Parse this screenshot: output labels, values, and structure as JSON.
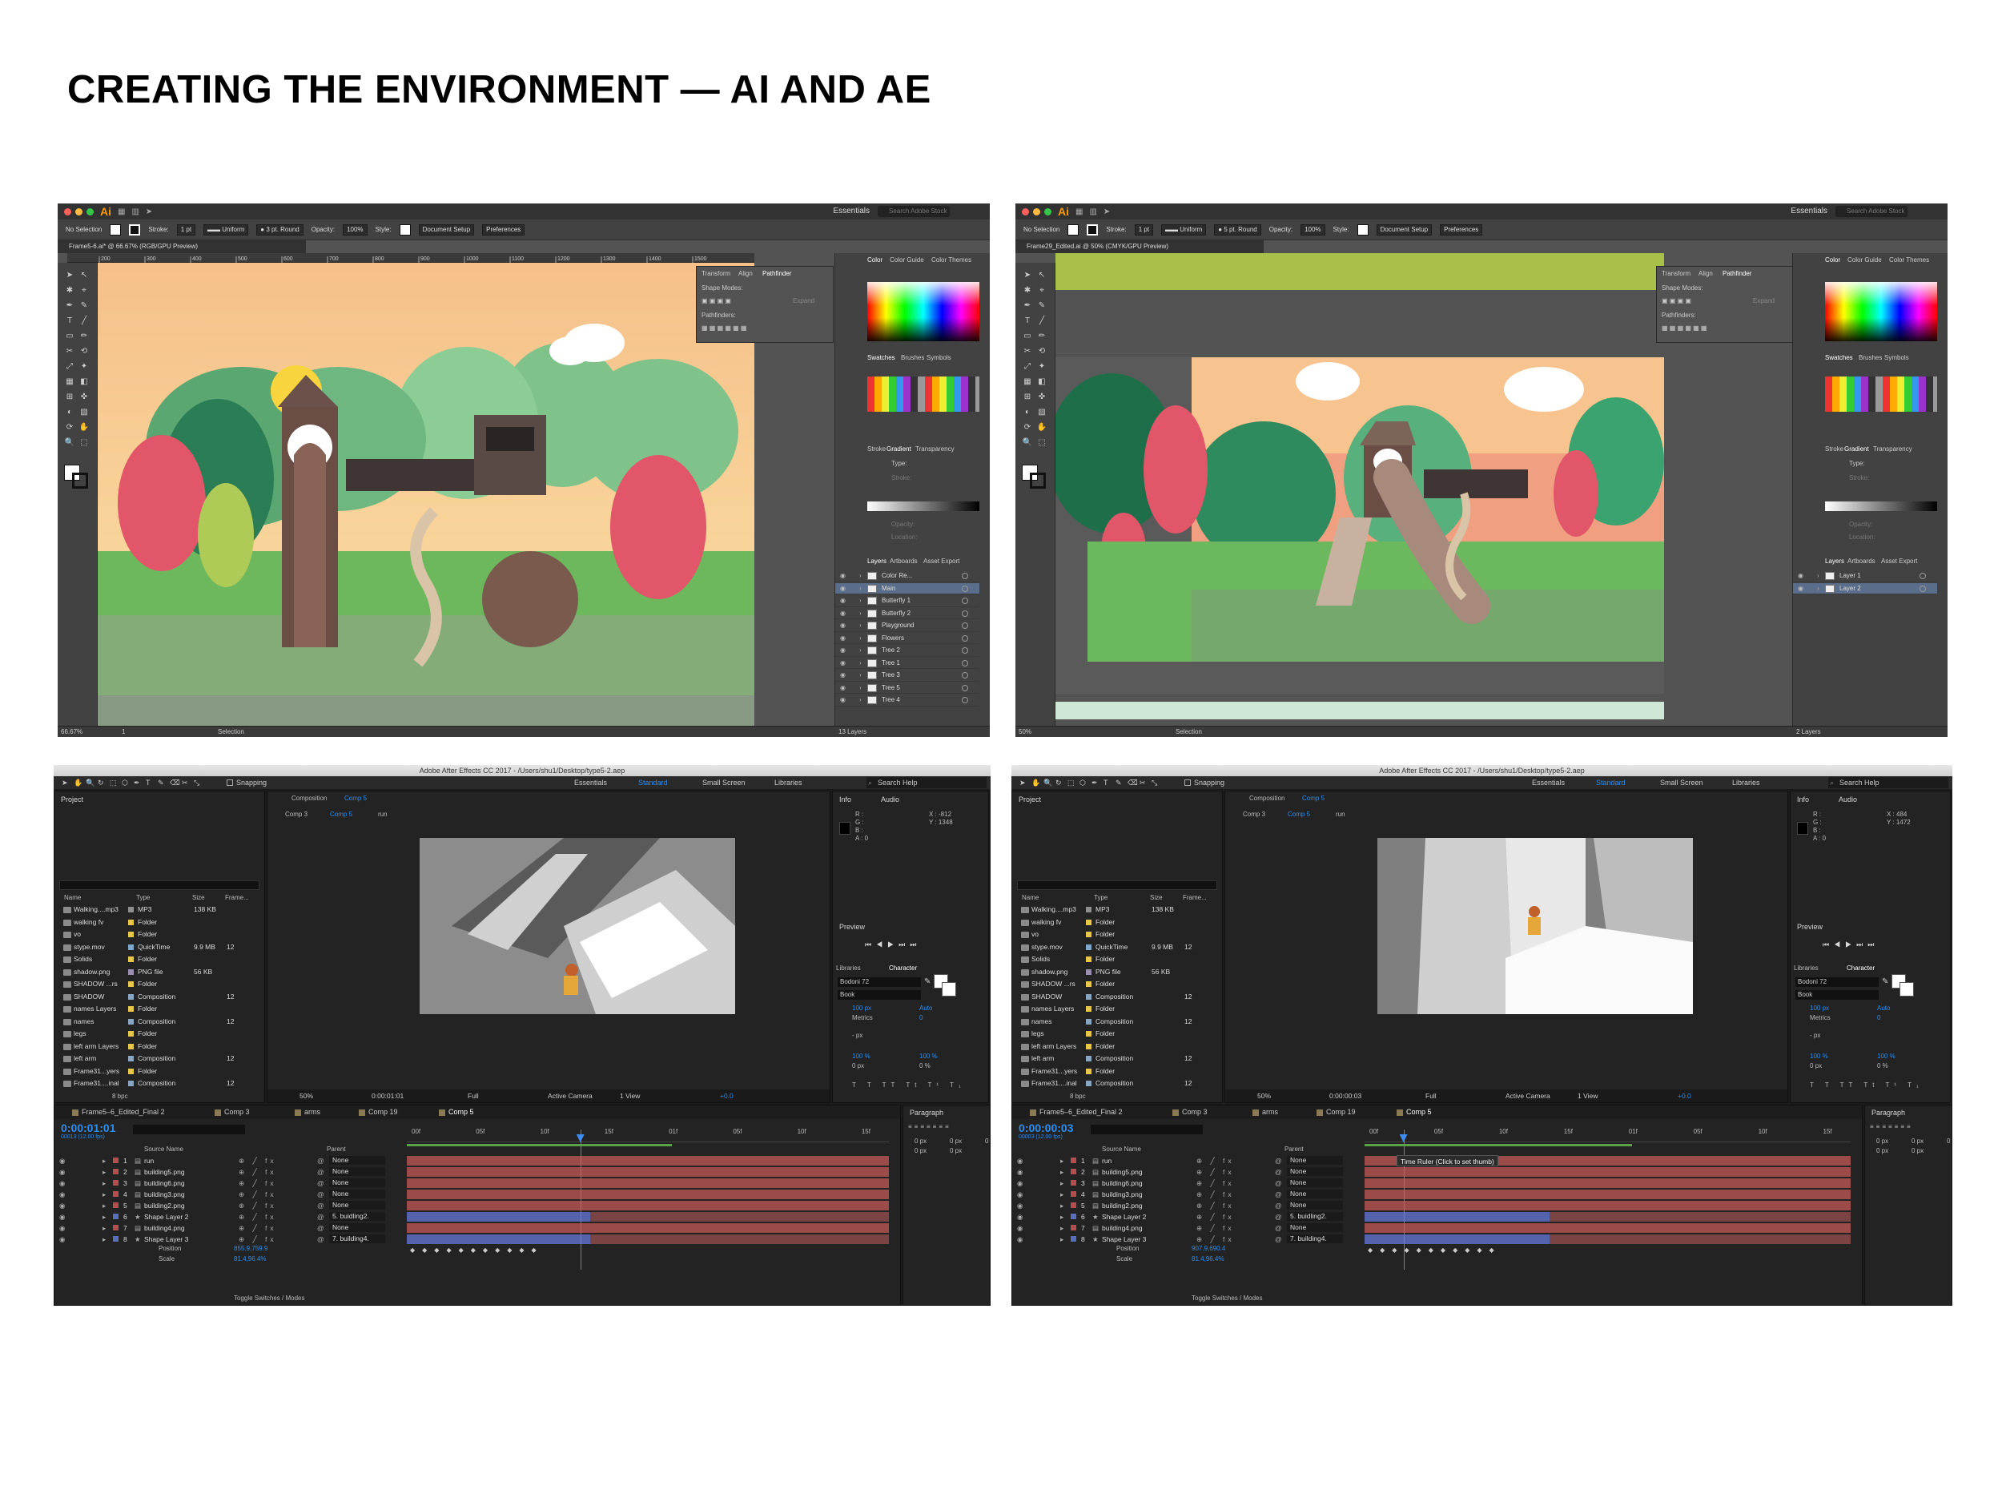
{
  "page": {
    "title": "CREATING THE ENVIRONMENT — AI AND AE"
  },
  "ai_left": {
    "app_logo": "Ai",
    "workspace": "Essentials",
    "search_placeholder": "Search Adobe Stock",
    "control": {
      "selection": "No Selection",
      "stroke_label": "Stroke:",
      "stroke_value": "1 pt",
      "uniform": "Uniform",
      "brush": "3 pt. Round",
      "opacity_label": "Opacity:",
      "opacity_value": "100%",
      "style_label": "Style:",
      "document_setup": "Document Setup",
      "preferences": "Preferences"
    },
    "doc_tab": "Frame5-6.ai* @ 66.67% (RGB/GPU Preview)",
    "ruler_ticks": [
      "200",
      "300",
      "400",
      "500",
      "600",
      "700",
      "800",
      "900",
      "1000",
      "1100",
      "1200",
      "1300",
      "1400",
      "1500"
    ],
    "floating_tabs": [
      "Transform",
      "Align",
      "Pathfinder"
    ],
    "shape_modes": "Shape Modes:",
    "pathfinders": "Pathfinders:",
    "expand": "Expand",
    "color_tabs": [
      "Color",
      "Color Guide",
      "Color Themes"
    ],
    "swatch_tabs": [
      "Swatches",
      "Brushes",
      "Symbols"
    ],
    "stroke_tabs": [
      "Stroke",
      "Gradient",
      "Transparency"
    ],
    "gradient_type": "Type:",
    "gradient_stroke": "Stroke:",
    "gradient_opacity": "Opacity:",
    "gradient_location": "Location:",
    "layer_tabs": [
      "Layers",
      "Artboards",
      "Asset Export"
    ],
    "layers": [
      "Color Re...",
      "Main",
      "Butterfly 1",
      "Butterfly 2",
      "Playground",
      "Flowers",
      "Tree 2",
      "Tree 1",
      "Tree 3",
      "Tree 5",
      "Tree 4"
    ],
    "status": {
      "zoom": "66.67%",
      "page": "1",
      "tool": "Selection",
      "layer_count": "13 Layers"
    }
  },
  "ai_right": {
    "app_logo": "Ai",
    "workspace": "Essentials",
    "search_placeholder": "Search Adobe Stock",
    "control": {
      "selection": "No Selection",
      "stroke_label": "Stroke:",
      "stroke_value": "1 pt",
      "uniform": "Uniform",
      "brush": "5 pt. Round",
      "opacity_label": "Opacity:",
      "opacity_value": "100%",
      "style_label": "Style:",
      "document_setup": "Document Setup",
      "preferences": "Preferences"
    },
    "doc_tab": "Frame29_Edited.ai @ 50% (CMYK/GPU Preview)",
    "floating_tabs": [
      "Transform",
      "Align",
      "Pathfinder"
    ],
    "shape_modes": "Shape Modes:",
    "pathfinders": "Pathfinders:",
    "expand": "Expand",
    "color_tabs": [
      "Color",
      "Color Guide",
      "Color Themes"
    ],
    "swatch_tabs": [
      "Swatches",
      "Brushes",
      "Symbols"
    ],
    "stroke_tabs": [
      "Stroke",
      "Gradient",
      "Transparency"
    ],
    "gradient_type": "Type:",
    "gradient_stroke": "Stroke:",
    "gradient_opacity": "Opacity:",
    "gradient_location": "Location:",
    "layer_tabs": [
      "Layers",
      "Artboards",
      "Asset Export"
    ],
    "layers": [
      "Layer 1",
      "Layer 2"
    ],
    "status": {
      "zoom": "50%",
      "tool": "Selection",
      "layer_count": "2 Layers"
    }
  },
  "ae_left": {
    "title": "Adobe After Effects CC 2017 - /Users/shu1/Desktop/type5-2.aep",
    "snapping": "Snapping",
    "workspaces": [
      "Essentials",
      "Standard",
      "Small Screen",
      "Libraries"
    ],
    "search_help": "Search Help",
    "project_label": "Project",
    "composition_label": "Composition",
    "comp_name": "Comp 5",
    "breadcrumb": [
      "Comp 3",
      "Comp 5",
      "run"
    ],
    "project_headers": [
      "Name",
      "Type",
      "Size",
      "Frame..."
    ],
    "project_items": [
      {
        "name": "Walking....mp3",
        "type": "MP3",
        "size": "138 KB",
        "frame": "",
        "color": "#8f8f8f"
      },
      {
        "name": "walking fv",
        "type": "Folder",
        "size": "",
        "frame": "",
        "color": "#e8c84a"
      },
      {
        "name": "vo",
        "type": "Folder",
        "size": "",
        "frame": "",
        "color": "#e8c84a"
      },
      {
        "name": "stype.mov",
        "type": "QuickTime",
        "size": "9.9 MB",
        "frame": "12",
        "color": "#7fa7c9"
      },
      {
        "name": "Solids",
        "type": "Folder",
        "size": "",
        "frame": "",
        "color": "#e8c84a"
      },
      {
        "name": "shadow.png",
        "type": "PNG file",
        "size": "56 KB",
        "frame": "",
        "color": "#9b8fb0"
      },
      {
        "name": "SHADOW ...rs",
        "type": "Folder",
        "size": "",
        "frame": "",
        "color": "#e8c84a"
      },
      {
        "name": "SHADOW",
        "type": "Composition",
        "size": "",
        "frame": "12",
        "color": "#8aa6c1"
      },
      {
        "name": "names Layers",
        "type": "Folder",
        "size": "",
        "frame": "",
        "color": "#e8c84a"
      },
      {
        "name": "names",
        "type": "Composition",
        "size": "",
        "frame": "12",
        "color": "#8aa6c1"
      },
      {
        "name": "legs",
        "type": "Folder",
        "size": "",
        "frame": "",
        "color": "#e8c84a"
      },
      {
        "name": "left arm Layers",
        "type": "Folder",
        "size": "",
        "frame": "",
        "color": "#e8c84a"
      },
      {
        "name": "left arm",
        "type": "Composition",
        "size": "",
        "frame": "12",
        "color": "#8aa6c1"
      },
      {
        "name": "Frame31...yers",
        "type": "Folder",
        "size": "",
        "frame": "",
        "color": "#e8c84a"
      },
      {
        "name": "Frame31....inal",
        "type": "Composition",
        "size": "",
        "frame": "12",
        "color": "#8aa6c1"
      }
    ],
    "bpc": "8 bpc",
    "info_tabs": [
      "Info",
      "Audio"
    ],
    "info_rgb": [
      "R :",
      "G :",
      "B :",
      "A : 0"
    ],
    "info_x": "X : -812",
    "info_y": "Y : 1348",
    "preview_label": "Preview",
    "libraries_label": "Libraries",
    "character_label": "Character",
    "font": "Bodoni 72",
    "font_style": "Book",
    "font_size": "100 px",
    "leading": "Auto",
    "kerning": "Metrics",
    "tracking": "0",
    "stroke_px": "- px",
    "vscale": "100 %",
    "hscale": "100 %",
    "baseline": "0 px",
    "tsume": "0 %",
    "viewer": {
      "zoom": "50%",
      "timecode": "0:00:01:01",
      "resolution": "Full",
      "camera": "Active Camera",
      "views": "1 View",
      "exposure": "+0.0"
    },
    "timeline_tabs": [
      "Frame5–6_Edited_Final 2",
      "Comp 3",
      "arms",
      "Comp 19",
      "Comp 5"
    ],
    "timecode": "0:00:01:01",
    "fps": "00013 (12.00 fps)",
    "source_name": "Source Name",
    "parent_label": "Parent",
    "layers": [
      {
        "num": "1",
        "name": "run",
        "parent": "None",
        "color": "#b54f4f"
      },
      {
        "num": "2",
        "name": "building5.png",
        "parent": "None",
        "color": "#b54f4f"
      },
      {
        "num": "3",
        "name": "building6.png",
        "parent": "None",
        "color": "#b54f4f"
      },
      {
        "num": "4",
        "name": "building3.png",
        "parent": "None",
        "color": "#b54f4f"
      },
      {
        "num": "5",
        "name": "building2.png",
        "parent": "None",
        "color": "#b54f4f"
      },
      {
        "num": "6",
        "name": "Shape Layer 2",
        "parent": "5. buidling2.",
        "color": "#5a6fb9"
      },
      {
        "num": "7",
        "name": "building4.png",
        "parent": "None",
        "color": "#b54f4f"
      },
      {
        "num": "8",
        "name": "Shape Layer 3",
        "parent": "7. building4.",
        "color": "#5a6fb9"
      }
    ],
    "position_label": "Position",
    "position_value": "855.9,759.9",
    "scale_label": "Scale",
    "scale_value": "81.4,96.4%",
    "ruler": [
      "00f",
      "05f",
      "10f",
      "15f",
      "01f",
      "05f",
      "10f",
      "15f"
    ],
    "toggle": "Toggle Switches / Modes",
    "paragraph_label": "Paragraph",
    "para_values": [
      "0 px",
      "0 px",
      "0 px",
      "0 px",
      "0 px"
    ],
    "playhead": 0.36
  },
  "ae_right": {
    "title": "Adobe After Effects CC 2017 - /Users/shu1/Desktop/type5-2.aep",
    "snapping": "Snapping",
    "workspaces": [
      "Essentials",
      "Standard",
      "Small Screen",
      "Libraries"
    ],
    "search_help": "Search Help",
    "project_label": "Project",
    "composition_label": "Composition",
    "comp_name": "Comp 5",
    "breadcrumb": [
      "Comp 3",
      "Comp 5",
      "run"
    ],
    "project_headers": [
      "Name",
      "Type",
      "Size",
      "Frame..."
    ],
    "project_items": [
      {
        "name": "Walking....mp3",
        "type": "MP3",
        "size": "138 KB",
        "frame": "",
        "color": "#8f8f8f"
      },
      {
        "name": "walking fv",
        "type": "Folder",
        "size": "",
        "frame": "",
        "color": "#e8c84a"
      },
      {
        "name": "vo",
        "type": "Folder",
        "size": "",
        "frame": "",
        "color": "#e8c84a"
      },
      {
        "name": "stype.mov",
        "type": "QuickTime",
        "size": "9.9 MB",
        "frame": "12",
        "color": "#7fa7c9"
      },
      {
        "name": "Solids",
        "type": "Folder",
        "size": "",
        "frame": "",
        "color": "#e8c84a"
      },
      {
        "name": "shadow.png",
        "type": "PNG file",
        "size": "56 KB",
        "frame": "",
        "color": "#9b8fb0"
      },
      {
        "name": "SHADOW ...rs",
        "type": "Folder",
        "size": "",
        "frame": "",
        "color": "#e8c84a"
      },
      {
        "name": "SHADOW",
        "type": "Composition",
        "size": "",
        "frame": "12",
        "color": "#8aa6c1"
      },
      {
        "name": "names Layers",
        "type": "Folder",
        "size": "",
        "frame": "",
        "color": "#e8c84a"
      },
      {
        "name": "names",
        "type": "Composition",
        "size": "",
        "frame": "12",
        "color": "#8aa6c1"
      },
      {
        "name": "legs",
        "type": "Folder",
        "size": "",
        "frame": "",
        "color": "#e8c84a"
      },
      {
        "name": "left arm Layers",
        "type": "Folder",
        "size": "",
        "frame": "",
        "color": "#e8c84a"
      },
      {
        "name": "left arm",
        "type": "Composition",
        "size": "",
        "frame": "12",
        "color": "#8aa6c1"
      },
      {
        "name": "Frame31...yers",
        "type": "Folder",
        "size": "",
        "frame": "",
        "color": "#e8c84a"
      },
      {
        "name": "Frame31....inal",
        "type": "Composition",
        "size": "",
        "frame": "12",
        "color": "#8aa6c1"
      }
    ],
    "bpc": "8 bpc",
    "info_tabs": [
      "Info",
      "Audio"
    ],
    "info_rgb": [
      "R :",
      "G :",
      "B :",
      "A : 0"
    ],
    "info_x": "X : 484",
    "info_y": "Y : 1472",
    "preview_label": "Preview",
    "libraries_label": "Libraries",
    "character_label": "Character",
    "font": "Bodoni 72",
    "font_style": "Book",
    "font_size": "100 px",
    "leading": "Auto",
    "kerning": "Metrics",
    "tracking": "0",
    "stroke_px": "- px",
    "vscale": "100 %",
    "hscale": "100 %",
    "baseline": "0 px",
    "tsume": "0 %",
    "viewer": {
      "zoom": "50%",
      "timecode": "0:00:00:03",
      "resolution": "Full",
      "camera": "Active Camera",
      "views": "1 View",
      "exposure": "+0.0"
    },
    "timeline_tabs": [
      "Frame5–6_Edited_Final 2",
      "Comp 3",
      "arms",
      "Comp 19",
      "Comp 5"
    ],
    "timecode": "0:00:00:03",
    "fps": "00003 (12.00 fps)",
    "source_name": "Source Name",
    "parent_label": "Parent",
    "layers": [
      {
        "num": "1",
        "name": "run",
        "parent": "None",
        "color": "#b54f4f"
      },
      {
        "num": "2",
        "name": "building5.png",
        "parent": "None",
        "color": "#b54f4f"
      },
      {
        "num": "3",
        "name": "building6.png",
        "parent": "None",
        "color": "#b54f4f"
      },
      {
        "num": "4",
        "name": "building3.png",
        "parent": "None",
        "color": "#b54f4f"
      },
      {
        "num": "5",
        "name": "building2.png",
        "parent": "None",
        "color": "#b54f4f"
      },
      {
        "num": "6",
        "name": "Shape Layer 2",
        "parent": "5. buidling2.",
        "color": "#5a6fb9"
      },
      {
        "num": "7",
        "name": "building4.png",
        "parent": "None",
        "color": "#b54f4f"
      },
      {
        "num": "8",
        "name": "Shape Layer 3",
        "parent": "7. building4.",
        "color": "#5a6fb9"
      }
    ],
    "position_label": "Position",
    "position_value": "907.9,690.4",
    "scale_label": "Scale",
    "scale_value": "81.4,96.4%",
    "tooltip": "Time Ruler (Click to set thumb)",
    "ruler": [
      "00f",
      "05f",
      "10f",
      "15f",
      "01f",
      "05f",
      "10f",
      "15f"
    ],
    "toggle": "Toggle Switches / Modes",
    "paragraph_label": "Paragraph",
    "para_values": [
      "0 px",
      "0 px",
      "0 px",
      "0 px",
      "0 px"
    ],
    "playhead": 0.08
  }
}
